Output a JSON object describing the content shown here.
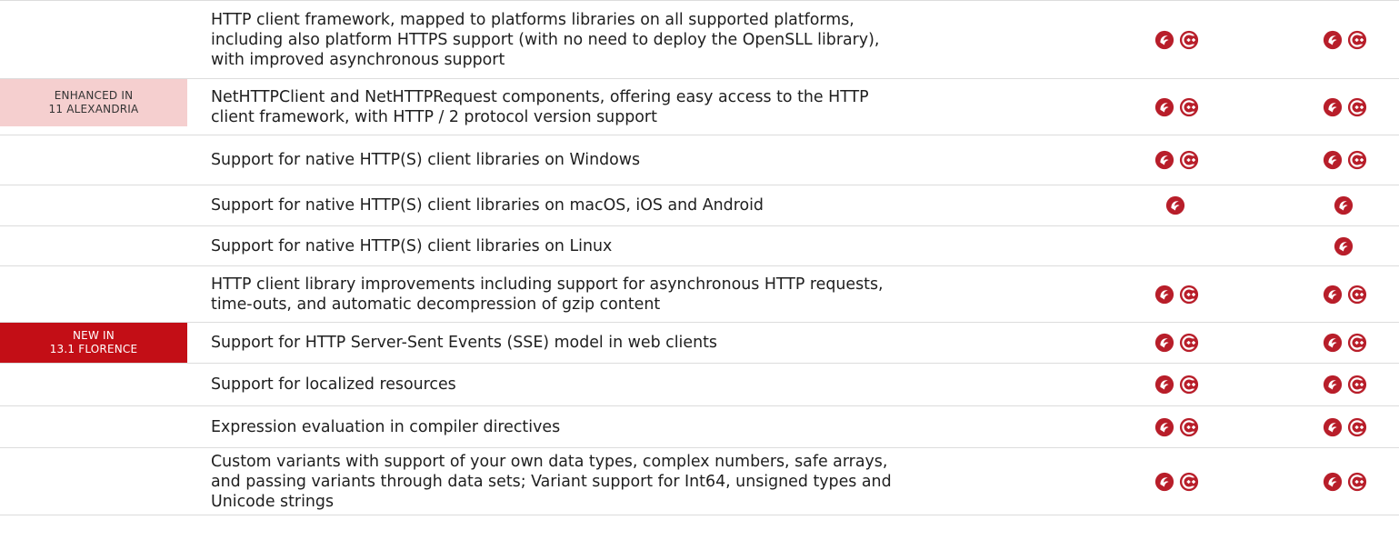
{
  "colors": {
    "accent_red": "#c30e16",
    "enhanced_badge_bg": "#f5cfcf",
    "icon_red": "#b81e2a"
  },
  "icons": {
    "delphi": "delphi-icon",
    "cpp": "cpp-builder-icon"
  },
  "rows": [
    {
      "badge": null,
      "feature_lines": [
        "HTTP client framework, mapped to platforms libraries on all supported platforms,",
        "including also platform HTTPS support (with no need to deploy the OpenSLL library),",
        "with improved asynchronous support"
      ],
      "col1": [
        "delphi",
        "cpp"
      ],
      "col2": [
        "delphi",
        "cpp"
      ]
    },
    {
      "badge": {
        "type": "enhanced",
        "line1": "ENHANCED IN",
        "line2": "11 ALEXANDRIA"
      },
      "feature_lines": [
        "NetHTTPClient and NetHTTPRequest components, offering easy access to the HTTP",
        "client framework, with HTTP / 2 protocol version support"
      ],
      "col1": [
        "delphi",
        "cpp"
      ],
      "col2": [
        "delphi",
        "cpp"
      ]
    },
    {
      "badge": null,
      "feature_lines": [
        "Support for native HTTP(S) client libraries on Windows"
      ],
      "col1": [
        "delphi",
        "cpp"
      ],
      "col2": [
        "delphi",
        "cpp"
      ]
    },
    {
      "badge": null,
      "feature_lines": [
        "Support for native HTTP(S) client libraries on macOS, iOS and Android"
      ],
      "col1": [
        "delphi"
      ],
      "col2": [
        "delphi"
      ]
    },
    {
      "badge": null,
      "feature_lines": [
        "Support for native HTTP(S) client libraries on Linux"
      ],
      "col1": [],
      "col2": [
        "delphi"
      ]
    },
    {
      "badge": null,
      "feature_lines": [
        "HTTP client library improvements including support for asynchronous HTTP requests,",
        "time-outs, and automatic decompression of gzip content"
      ],
      "col1": [
        "delphi",
        "cpp"
      ],
      "col2": [
        "delphi",
        "cpp"
      ]
    },
    {
      "badge": {
        "type": "new",
        "line1": "NEW IN",
        "line2": "13.1 FLORENCE"
      },
      "feature_lines": [
        "Support for HTTP Server-Sent Events (SSE) model in web clients"
      ],
      "col1": [
        "delphi",
        "cpp"
      ],
      "col2": [
        "delphi",
        "cpp"
      ]
    },
    {
      "badge": null,
      "feature_lines": [
        "Support for localized resources"
      ],
      "col1": [
        "delphi",
        "cpp"
      ],
      "col2": [
        "delphi",
        "cpp"
      ]
    },
    {
      "badge": null,
      "feature_lines": [
        "Expression evaluation in compiler directives"
      ],
      "col1": [
        "delphi",
        "cpp"
      ],
      "col2": [
        "delphi",
        "cpp"
      ]
    },
    {
      "badge": null,
      "feature_lines": [
        "Custom variants with support of your own data types, complex numbers, safe arrays,",
        "and passing variants through data sets; Variant support for Int64, unsigned types and",
        "Unicode strings"
      ],
      "col1": [
        "delphi",
        "cpp"
      ],
      "col2": [
        "delphi",
        "cpp"
      ]
    }
  ]
}
